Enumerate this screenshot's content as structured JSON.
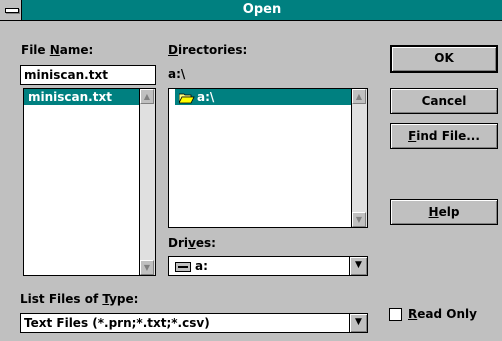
{
  "window": {
    "title": "Open"
  },
  "file_name": {
    "label_pre": "File ",
    "label_key": "N",
    "label_post": "ame:",
    "value": "miniscan.txt",
    "files": [
      {
        "name": "miniscan.txt",
        "selected": true
      }
    ]
  },
  "directories": {
    "label_key": "D",
    "label_post": "irectories:",
    "current_path": "a:\\",
    "items": [
      {
        "name": "a:\\",
        "icon": "open-folder-icon",
        "selected": true
      }
    ]
  },
  "drives": {
    "label_pre": "Dri",
    "label_key": "v",
    "label_post": "es:",
    "value": "a:",
    "icon": "floppy-drive-icon"
  },
  "file_type": {
    "label_pre": "List Files of ",
    "label_key": "T",
    "label_post": "ype:",
    "value": "Text Files (*.prn;*.txt;*.csv)"
  },
  "buttons": {
    "ok": "OK",
    "cancel": "Cancel",
    "find_file_key": "F",
    "find_file_post": "ind File...",
    "help_key": "H",
    "help_post": "elp"
  },
  "read_only": {
    "key": "R",
    "post": "ead Only",
    "checked": false
  },
  "colors": {
    "title_bar": "#008080",
    "selection": "#008080",
    "face": "#c0c0c0"
  }
}
